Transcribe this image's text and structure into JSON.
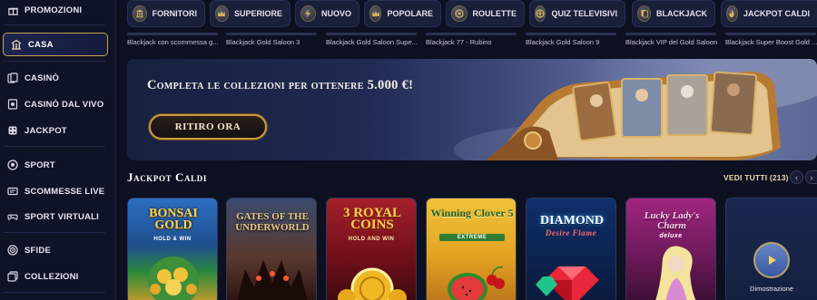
{
  "sidebar": {
    "items": [
      {
        "label": "PROMOZIONI",
        "icon": "gift-icon"
      },
      {
        "label": "CASA",
        "icon": "home-icon",
        "active": true
      },
      {
        "label": "CASINÒ",
        "icon": "cards-icon"
      },
      {
        "label": "CASINÒ DAL VIVO",
        "icon": "live-icon"
      },
      {
        "label": "JACKPOT",
        "icon": "dice-icon"
      },
      {
        "label": "SPORT",
        "icon": "ball-icon"
      },
      {
        "label": "SCOMMESSE LIVE",
        "icon": "ticket-icon"
      },
      {
        "label": "SPORT VIRTUALI",
        "icon": "gamepad-icon"
      },
      {
        "label": "SFIDE",
        "icon": "target-icon"
      },
      {
        "label": "COLLEZIONI",
        "icon": "stack-icon"
      }
    ]
  },
  "categories": [
    {
      "label": "FORNITORI",
      "icon": "temple-icon"
    },
    {
      "label": "SUPERIORE",
      "icon": "crown-icon"
    },
    {
      "label": "NUOVO",
      "icon": "lightning-icon"
    },
    {
      "label": "POPOLARE",
      "icon": "crown-icon"
    },
    {
      "label": "ROULETTE",
      "icon": "roulette-icon"
    },
    {
      "label": "QUIZ TELEVISIVI",
      "icon": "wheel-icon"
    },
    {
      "label": "BLACKJACK",
      "icon": "blackjack-icon"
    },
    {
      "label": "JACKPOT CALDI",
      "icon": "flame-icon"
    }
  ],
  "sub_games": [
    "Blackjack con scommessa g...",
    "Blackjack Gold Saloon 3",
    "Blackjack Gold Saloon Supe...",
    "Blackjack 77 - Rubino",
    "Blackjack Gold Saloon 9",
    "Blackjack VIP del Gold Saloon",
    "Blackjack Super Boost Gold ..."
  ],
  "banner": {
    "title": "Completa le collezioni per ottenere 5.000 €!",
    "button": "RITIRO ORA"
  },
  "jackpot_section": {
    "title": "Jackpot Caldi",
    "see_all": "VEDI TUTTI (213)",
    "prev_icon": "chevron-left-icon",
    "next_icon": "chevron-right-icon"
  },
  "games": [
    {
      "title": "BONSAI GOLD",
      "sub": "HOLD & WIN",
      "bg": "#1f5aa8",
      "accent": "#e8b63a"
    },
    {
      "title": "GATES OF THE UNDERWORLD",
      "sub": "",
      "bg": "#2c3a55",
      "accent": "#d6b36a"
    },
    {
      "title": "3 ROYAL COINS",
      "sub": "HOLD AND WIN",
      "bg": "#7b1420",
      "accent": "#f2c13a"
    },
    {
      "title": "Winning Clover 5",
      "sub": "EXTREME",
      "bg": "#d9a21b",
      "accent": "#2e7d32"
    },
    {
      "title": "DIAMOND",
      "sub": "Desire Flame",
      "bg": "#0e2a5e",
      "accent": "#ff4d5a"
    },
    {
      "title": "Lucky Lady's Charm",
      "sub": "deluxe",
      "bg": "#8a1f6e",
      "accent": "#f6c9e0"
    }
  ],
  "demo_card": {
    "label": "Dimostrazione"
  },
  "colors": {
    "accent_gold": "#c9a24d",
    "bg": "#0d1021",
    "sidebar": "#0f1326"
  }
}
